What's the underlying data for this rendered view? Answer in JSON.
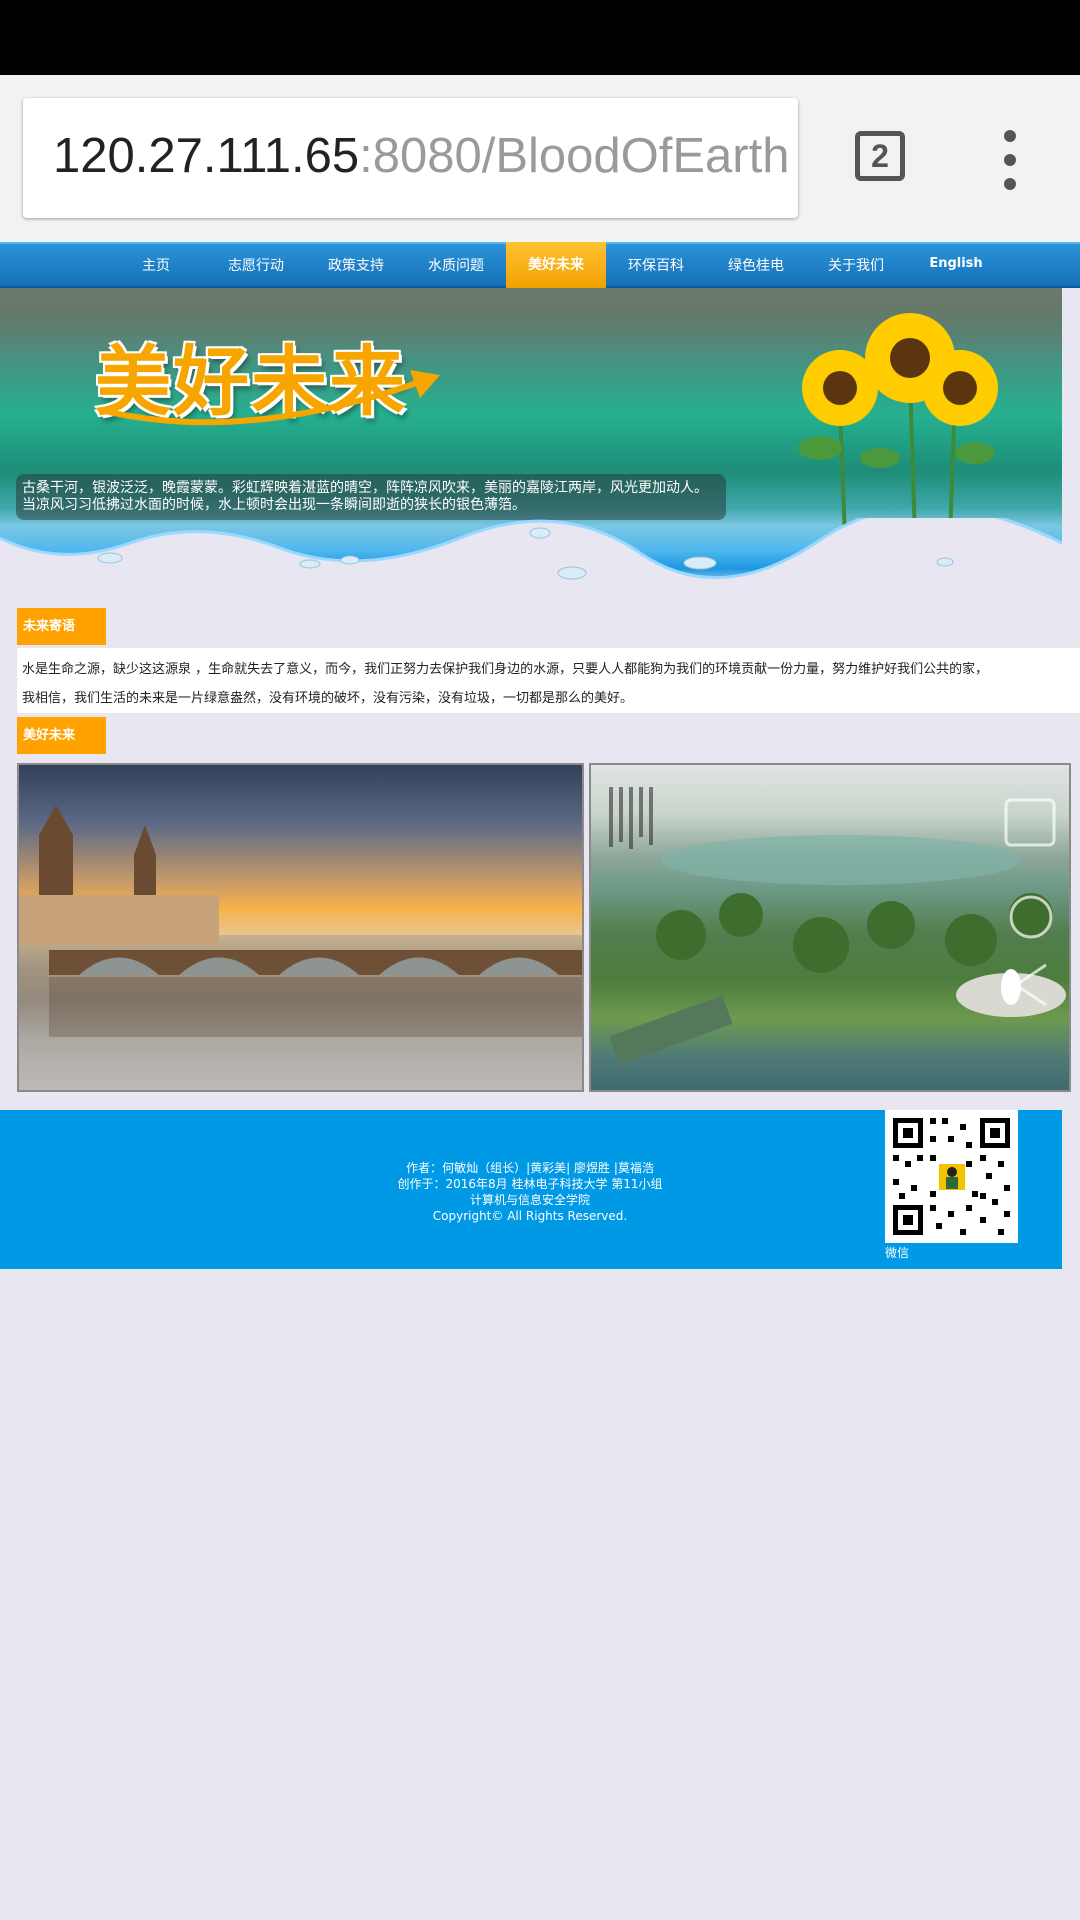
{
  "browser": {
    "url_host": "120.27.111.65",
    "url_path": ":8080/BloodOfEarth",
    "tab_count": "2"
  },
  "nav": {
    "items": [
      {
        "label": "主页"
      },
      {
        "label": "志愿行动"
      },
      {
        "label": "政策支持"
      },
      {
        "label": "水质问题"
      },
      {
        "label": "美好未来",
        "active": true
      },
      {
        "label": "环保百科"
      },
      {
        "label": "绿色桂电"
      },
      {
        "label": "关于我们"
      },
      {
        "label": "English"
      }
    ]
  },
  "banner": {
    "title": "美好未来",
    "caption_line1": "古桑干河，银波泛泛，晚霞蒙蒙。彩虹辉映着湛蓝的晴空，阵阵凉风吹来，美丽的嘉陵江两岸，风光更加动人。",
    "caption_line2": "当凉风习习低拂过水面的时候，水上顿时会出现一条瞬间即逝的狭长的银色薄箔。"
  },
  "section1": {
    "label": "未来寄语",
    "line1": "水是生命之源，缺少这这源泉 ，生命就失去了意义，而今，我们正努力去保护我们身边的水源，只要人人都能狗为我们的环境贡献一份力量，努力维护好我们公共的家，",
    "line2": "我相信，我们生活的未来是一片绿意盎然，没有环境的破坏，没有污染，没有垃圾，一切都是那么的美好。"
  },
  "section2": {
    "label": "美好未来"
  },
  "footer": {
    "line1": "作者：何敏灿（组长）|黄彩美| 廖煜胜 |莫福浩",
    "line2": "创作于：2016年8月  桂林电子科技大学 第11小组",
    "line3": "计算机与信息安全学院",
    "line4": "Copyright© All Rights Reserved.",
    "qr_label": "微信"
  },
  "colors": {
    "nav_blue": "#1e82cc",
    "accent_orange": "#ffa200",
    "footer_blue": "#0099e5"
  }
}
